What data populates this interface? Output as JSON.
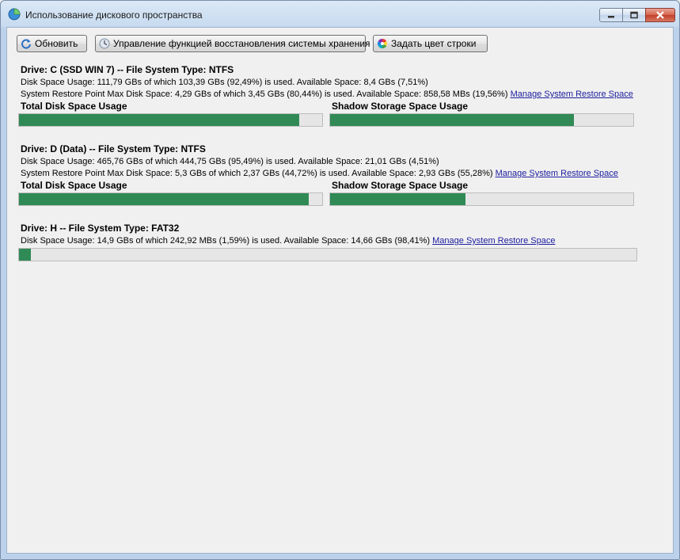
{
  "window": {
    "title": "Использование дискового пространства"
  },
  "toolbar": {
    "refresh_label": "Обновить",
    "restore_label": "Управление функцией восстановления системы хранения",
    "color_label": "Задать цвет строки"
  },
  "bar_labels": {
    "total": "Total Disk Space Usage",
    "shadow": "Shadow Storage Space Usage"
  },
  "drives": [
    {
      "title": "Drive: C (SSD WIN 7) -- File System Type: NTFS",
      "usage": "Disk Space Usage: 111,79 GBs of which 103,39 GBs (92,49%) is used.  Available Space: 8,4 GBs (7,51%)",
      "restore": "System Restore Point Max Disk Space: 4,29 GBs of which 3,45 GBs (80,44%) is used.  Available Space: 858,58 MBs (19,56%)",
      "link": "Manage System Restore Space",
      "total_pct": 92.49,
      "shadow_pct": 80.44
    },
    {
      "title": "Drive: D (Data) -- File System Type: NTFS",
      "usage": "Disk Space Usage: 465,76 GBs of which 444,75 GBs (95,49%) is used.  Available Space: 21,01 GBs (4,51%)",
      "restore": "System Restore Point Max Disk Space: 5,3 GBs of which 2,37 GBs (44,72%) is used.  Available Space: 2,93 GBs (55,28%)",
      "link": "Manage System Restore Space",
      "total_pct": 95.49,
      "shadow_pct": 44.72
    },
    {
      "title": "Drive: H -- File System Type: FAT32",
      "usage": "Disk Space Usage: 14,9 GBs of which 242,92 MBs (1,59%) is used.  Available Space: 14,66 GBs (98,41%)",
      "link": "Manage System Restore Space",
      "total_pct": 1.59
    }
  ],
  "colors": {
    "bar_fill": "#2f8a55",
    "link": "#2020a0"
  }
}
